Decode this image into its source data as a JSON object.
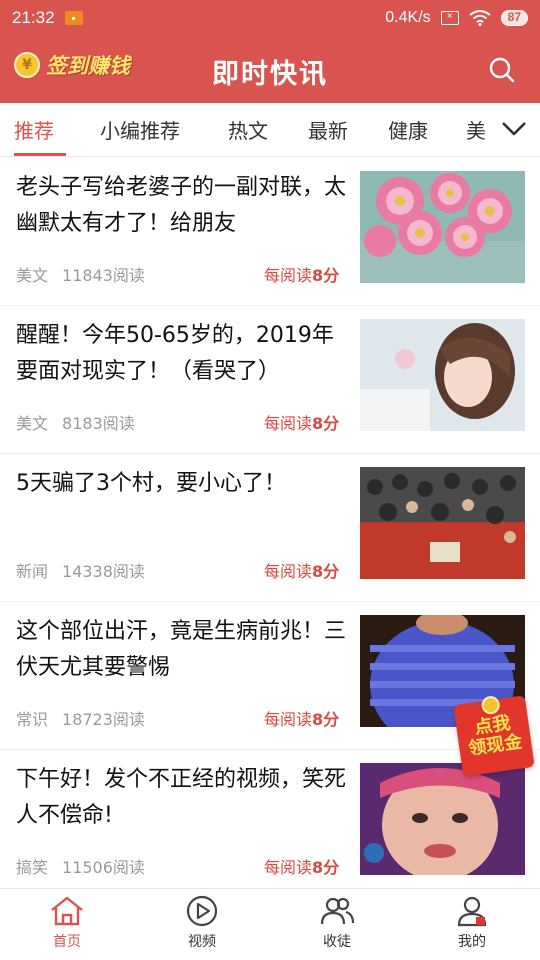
{
  "status_bar": {
    "time": "21:32",
    "network_speed": "0.4K/s",
    "battery": "87",
    "notif_icon": "app-notification-icon"
  },
  "header": {
    "signin_label": "签到赚钱",
    "title": "即时快讯"
  },
  "tabs": [
    {
      "label": "推荐",
      "active": true
    },
    {
      "label": "小编推荐"
    },
    {
      "label": "热文"
    },
    {
      "label": "最新"
    },
    {
      "label": "健康"
    },
    {
      "label": "美"
    }
  ],
  "feed": [
    {
      "title": "老头子写给老婆子的一副对联，太幽默太有才了！给朋友",
      "category": "美文",
      "reads": "11843阅读",
      "reward_prefix": "每阅读",
      "reward_value": "8分",
      "thumb": "pink-flowers"
    },
    {
      "title": "醒醒！今年50-65岁的，2019年要面对现实了！（看哭了）",
      "category": "美文",
      "reads": "8183阅读",
      "reward_prefix": "每阅读",
      "reward_value": "8分",
      "thumb": "portrait-girl"
    },
    {
      "title": "5天骗了3个村，要小心了！",
      "category": "新闻",
      "reads": "14338阅读",
      "reward_prefix": "每阅读",
      "reward_value": "8分",
      "thumb": "crowd"
    },
    {
      "title": "这个部位出汗，竟是生病前兆！三伏天尤其要警惕",
      "category": "常识",
      "reads": "18723阅读",
      "reward_prefix": "每阅读",
      "reward_value": "8分",
      "thumb": "blue-shirt-sweat"
    },
    {
      "title": "下午好！发个不正经的视频，笑死人不偿命!",
      "category": "搞笑",
      "reads": "11506阅读",
      "reward_prefix": "每阅读",
      "reward_value": "8分",
      "thumb": "funny-face"
    }
  ],
  "cash_badge": {
    "line1": "点我",
    "line2": "领现金"
  },
  "bottom_nav": [
    {
      "label": "首页",
      "icon": "home-icon",
      "active": true
    },
    {
      "label": "视频",
      "icon": "play-icon"
    },
    {
      "label": "收徒",
      "icon": "users-icon"
    },
    {
      "label": "我的",
      "icon": "profile-icon"
    }
  ],
  "colors": {
    "accent": "#d9534f",
    "reward": "#e0463d",
    "muted": "#9a9a9a"
  }
}
